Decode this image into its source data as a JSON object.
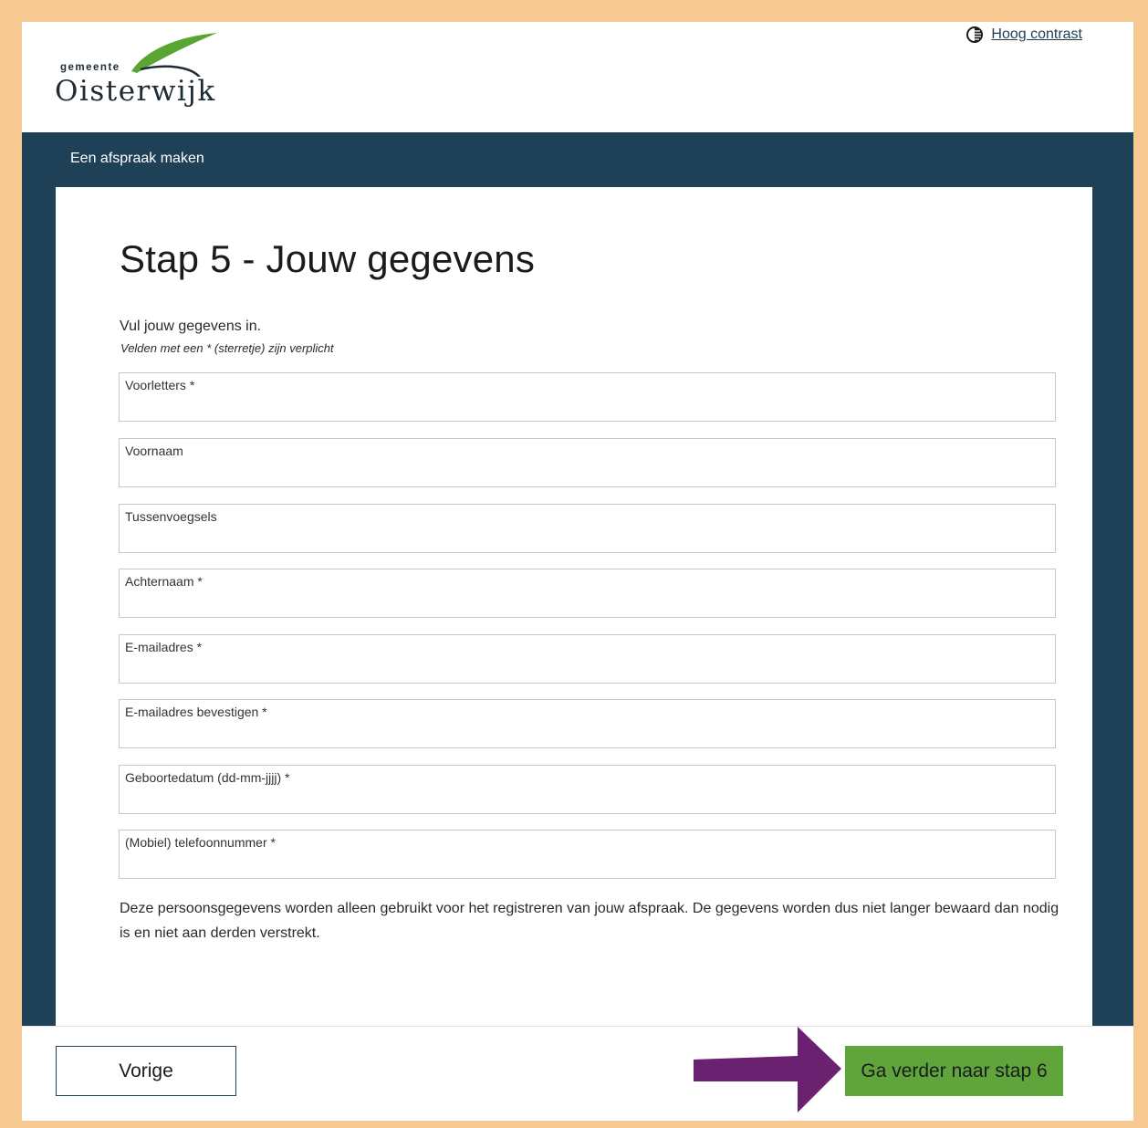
{
  "header": {
    "logo_small": "gemeente",
    "logo_big": "Oisterwijk",
    "contrast_link": "Hoog contrast",
    "contrast_icon": "contrast-icon"
  },
  "nav": {
    "title": "Een afspraak maken"
  },
  "main": {
    "title": "Stap 5 - Jouw gegevens",
    "intro": "Vul jouw gegevens in.",
    "required_note": "Velden met een * (sterretje) zijn verplicht",
    "fields": [
      {
        "label": "Voorletters *",
        "value": ""
      },
      {
        "label": "Voornaam",
        "value": ""
      },
      {
        "label": "Tussenvoegsels",
        "value": ""
      },
      {
        "label": "Achternaam *",
        "value": ""
      },
      {
        "label": "E-mailadres *",
        "value": ""
      },
      {
        "label": "E-mailadres bevestigen *",
        "value": ""
      },
      {
        "label": "Geboortedatum (dd-mm-jjjj) *",
        "value": ""
      },
      {
        "label": "(Mobiel) telefoonnummer *",
        "value": ""
      }
    ],
    "privacy": "Deze persoonsgegevens worden alleen gebruikt voor het registreren van jouw afspraak. De gegevens worden dus niet langer bewaard dan nodig is en niet aan derden verstrekt."
  },
  "footer": {
    "prev_label": "Vorige",
    "next_label": "Ga verder naar stap 6"
  },
  "colors": {
    "border_frame": "#f6c892",
    "nav_bar": "#1f4157",
    "next_button": "#5fa53c",
    "annotation_arrow": "#6a2170",
    "logo_leaf": "#5aa532"
  }
}
